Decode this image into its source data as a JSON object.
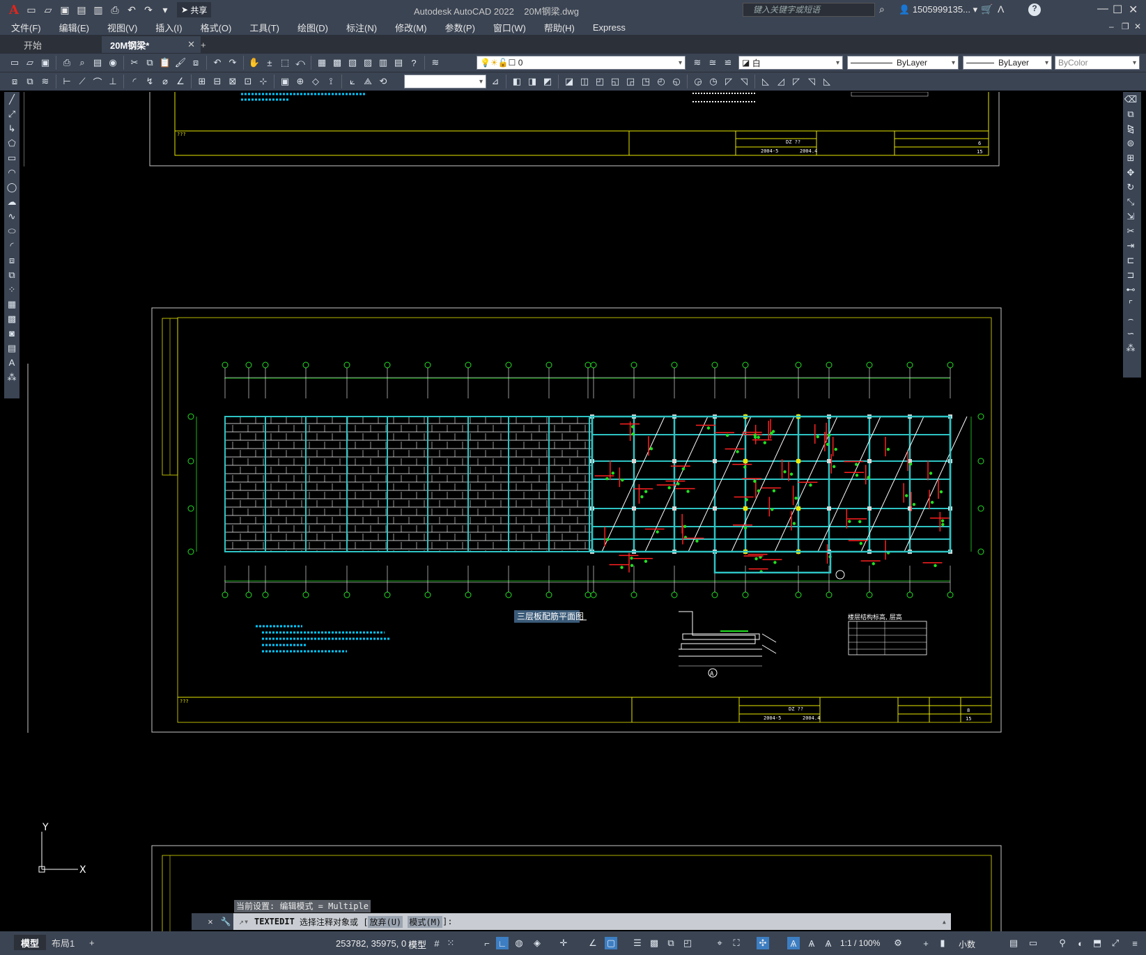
{
  "app": {
    "title": "Autodesk AutoCAD 2022",
    "file": "20M钢梁.dwg",
    "search_placeholder": "键入关键字或短语",
    "user": "1505999135...",
    "share": "共享"
  },
  "menu": [
    "文件(F)",
    "编辑(E)",
    "视图(V)",
    "插入(I)",
    "格式(O)",
    "工具(T)",
    "绘图(D)",
    "标注(N)",
    "修改(M)",
    "参数(P)",
    "窗口(W)",
    "帮助(H)",
    "Express"
  ],
  "tabs": [
    {
      "label": "开始",
      "active": false
    },
    {
      "label": "20M钢梁*",
      "active": true
    }
  ],
  "layers": {
    "current_layer": "0",
    "color": "白",
    "linetype": "ByLayer",
    "lineweight": "ByLayer",
    "plotstyle": "ByColor"
  },
  "drawing": {
    "plan_title": "三层板配筋平面图",
    "floor_table_title": "楼层结构标高, 层高",
    "title_block": {
      "date1": "2004-5",
      "date2": "2004.4",
      "sheet_top": "6",
      "sheet_mid": "8",
      "total": "15",
      "placeholder": "???",
      "mark": "DZ ??"
    },
    "axis_marker": "A"
  },
  "command": {
    "history": "当前设置: 编辑模式 = Multiple",
    "prompt_cmd": "TEXTEDIT",
    "prompt_text": "选择注释对象或 [",
    "opt1": "放弃(U)",
    "opt2": "模式(M)",
    "prompt_end": "]:"
  },
  "ucs": {
    "x": "X",
    "y": "Y"
  },
  "layout_tabs": [
    "模型",
    "布局1",
    "+"
  ],
  "status": {
    "coords": "253782, 35975, 0",
    "space": "模型",
    "scale": "1:1 / 100%",
    "units": "小数"
  },
  "colors": {
    "chrome": "#3b4453",
    "cyan_beam": "#2ec4c4",
    "green_axis": "#22e022",
    "red_rebar": "#ff2020",
    "yellow_frame": "#e8e800",
    "white_line": "#ffffff"
  }
}
